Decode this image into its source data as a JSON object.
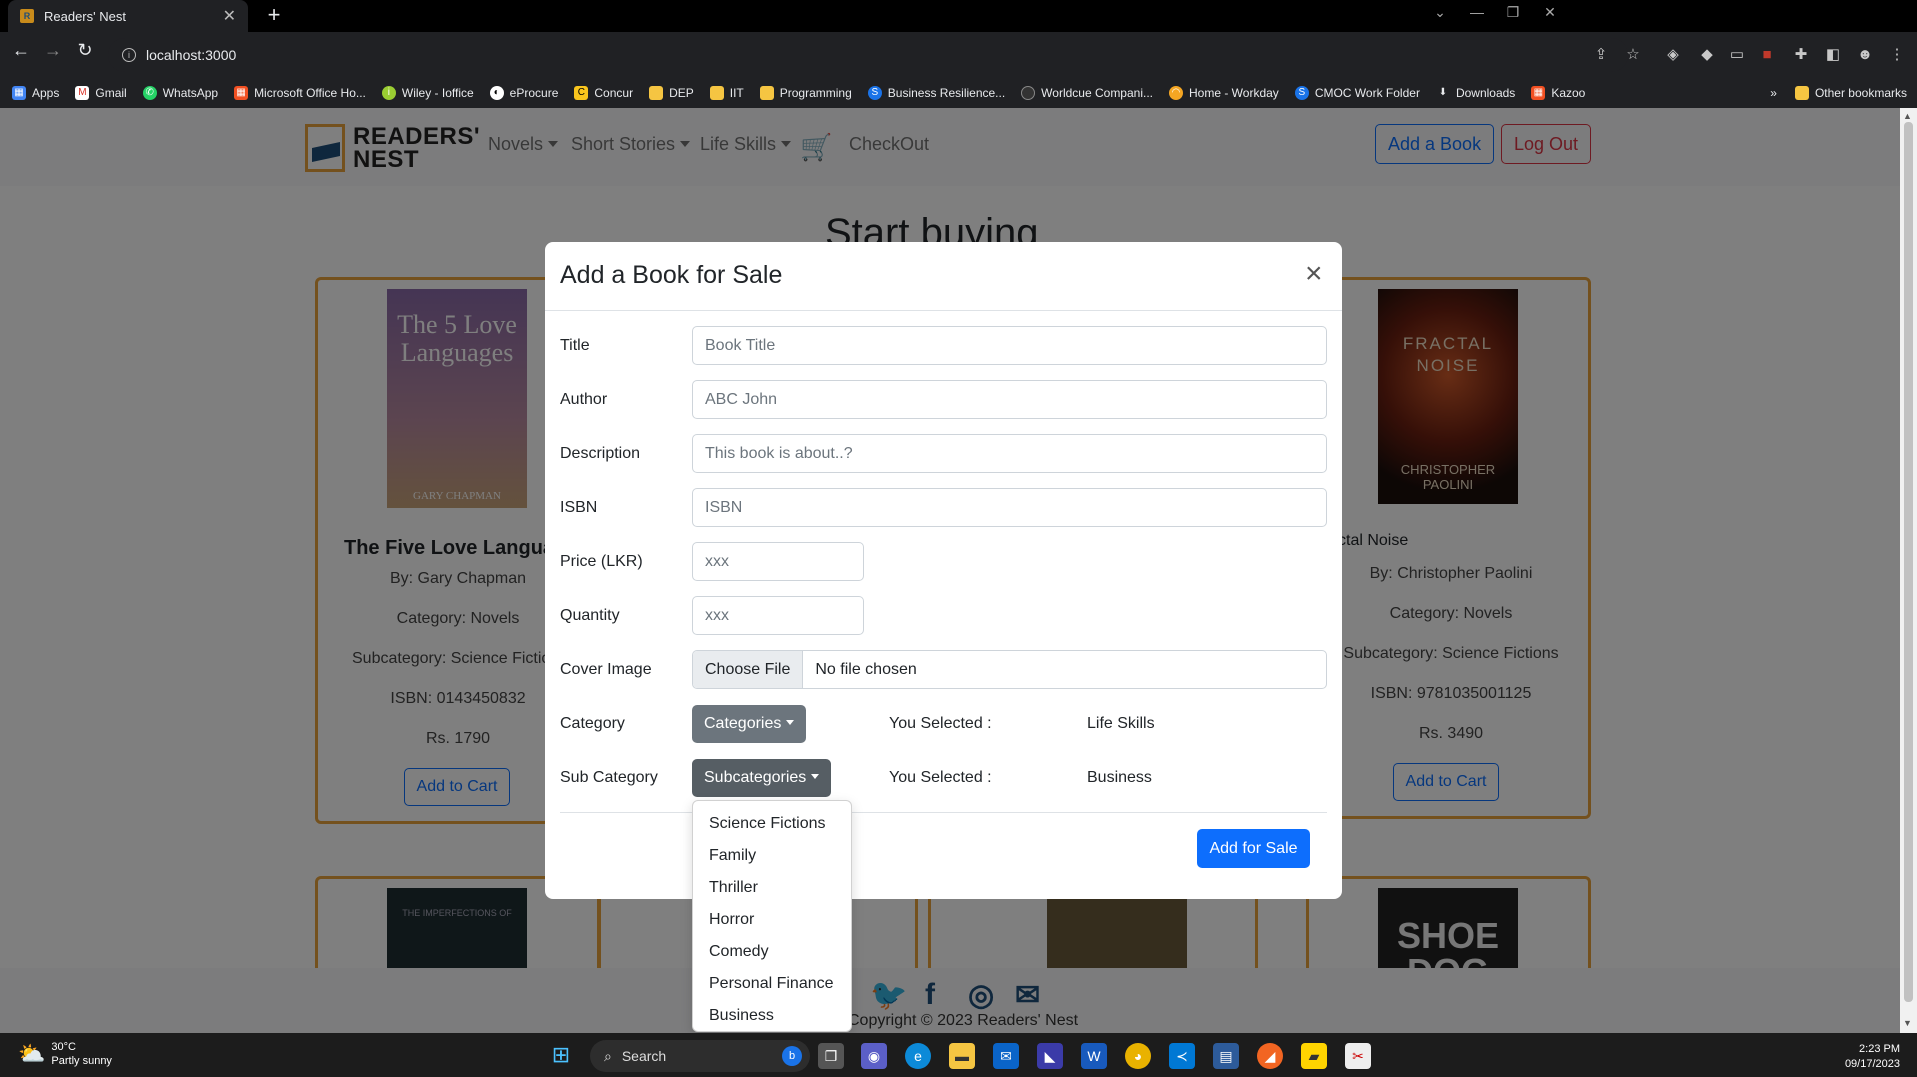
{
  "browser": {
    "tab_title": "Readers' Nest",
    "url": "localhost:3000",
    "bookmarks": [
      "Apps",
      "Gmail",
      "WhatsApp",
      "Microsoft Office Ho...",
      "Wiley - Ioffice",
      "eProcure",
      "Concur",
      "DEP",
      "IIT",
      "Programming",
      "Business Resilience...",
      "Worldcue Compani...",
      "Home - Workday",
      "CMOC Work Folder",
      "Downloads",
      "Kazoo"
    ],
    "other_bookmarks": "Other bookmarks",
    "more_bookmarks": "»"
  },
  "site": {
    "brand_line1": "READERS'",
    "brand_line2": "NEST",
    "nav": {
      "novels": "Novels",
      "short_stories": "Short Stories",
      "life_skills": "Life Skills",
      "checkout": "CheckOut"
    },
    "add_book": "Add a Book",
    "log_out": "Log Out",
    "heading": "Start buying",
    "cards": [
      {
        "cover_title": "The 5 Love Languages",
        "cover_author": "GARY CHAPMAN",
        "title": "The Five Love Languages",
        "author": "By: Gary Chapman",
        "category": "Category: Novels",
        "subcategory": "Subcategory: Science Fictions",
        "isbn": "ISBN: 0143450832",
        "price": "Rs. 1790",
        "button": "Add to Cart"
      },
      {
        "cover_title": "FRACTAL NOISE",
        "cover_author": "CHRISTOPHER PAOLINI",
        "title": "Fractal Noise",
        "author": "By: Christopher Paolini",
        "category": "Category: Novels",
        "subcategory": "Subcategory: Science Fictions",
        "isbn": "ISBN: 9781035001125",
        "price": "Rs. 3490",
        "button": "Add to Cart"
      }
    ],
    "row2_covers": [
      "THE IMPERFECTIONS OF",
      "SHOE DOG"
    ],
    "copyright": "Copyright © 2023 Readers' Nest"
  },
  "modal": {
    "title": "Add a Book for Sale",
    "close": "×",
    "fields": {
      "title_label": "Title",
      "title_placeholder": "Book Title",
      "author_label": "Author",
      "author_placeholder": "ABC John",
      "description_label": "Description",
      "description_placeholder": "This book is about..?",
      "isbn_label": "ISBN",
      "isbn_placeholder": "ISBN",
      "price_label": "Price (LKR)",
      "price_placeholder": "xxx",
      "quantity_label": "Quantity",
      "quantity_placeholder": "xxx",
      "cover_label": "Cover Image",
      "choose_file": "Choose File",
      "no_file": "No file chosen",
      "category_label": "Category",
      "category_button": "Categories",
      "category_selected_label": "You Selected :",
      "category_selected": "Life Skills",
      "subcategory_label": "Sub Category",
      "subcategory_button": "Subcategories",
      "subcategory_selected_label": "You Selected :",
      "subcategory_selected": "Business"
    },
    "submit": "Add for Sale",
    "subcategory_options": [
      "Science Fictions",
      "Family",
      "Thriller",
      "Horror",
      "Comedy",
      "Personal Finance",
      "Business"
    ]
  },
  "taskbar": {
    "weather_temp": "30°C",
    "weather_desc": "Partly sunny",
    "search": "Search",
    "time": "2:23 PM",
    "date": "09/17/2023"
  },
  "colors": {
    "accent": "#0d6efd",
    "card_border": "#e8a33d",
    "brand_blue": "#1e4f7a",
    "secondary": "#6c757d",
    "danger": "#dc3545"
  }
}
